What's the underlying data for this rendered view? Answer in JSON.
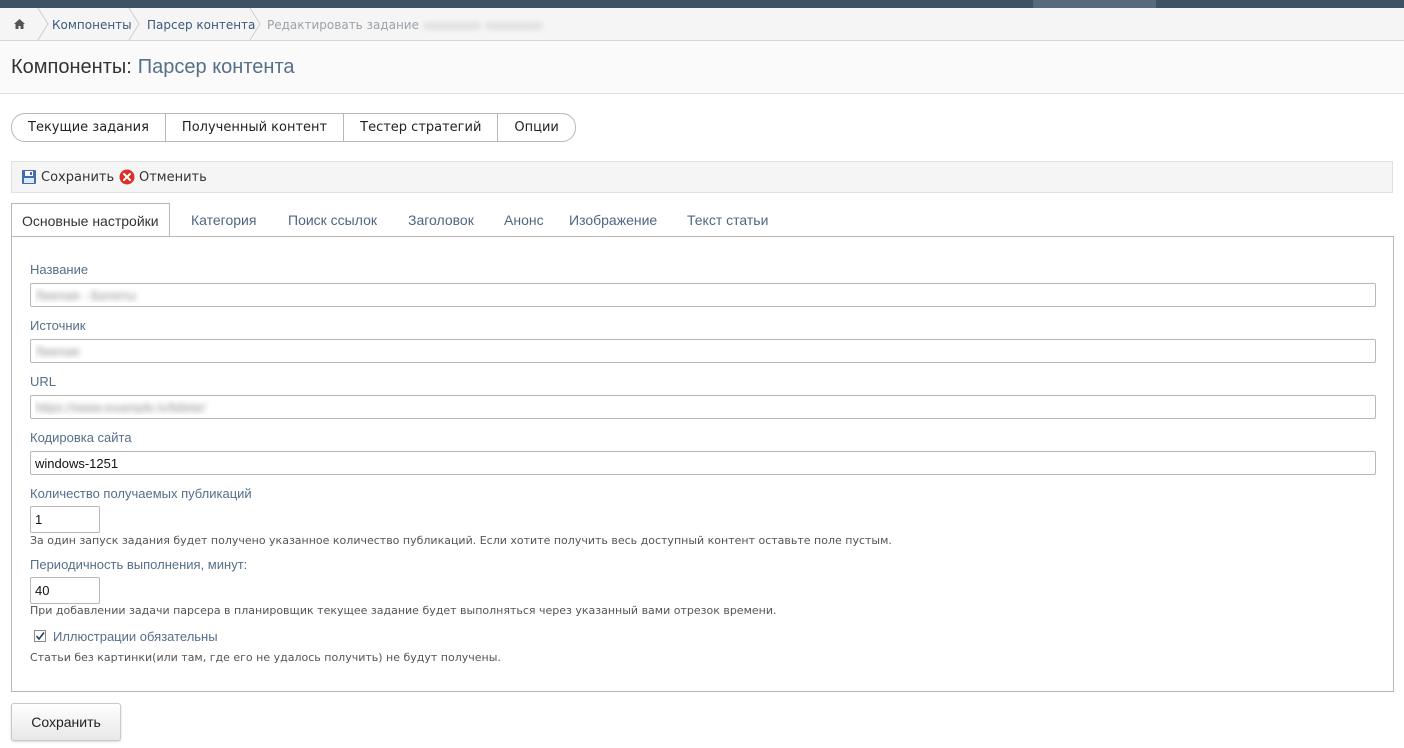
{
  "breadcrumb": {
    "items": [
      "Компоненты",
      "Парсер контента"
    ],
    "current": "Редактировать задание"
  },
  "header": {
    "title": "Компоненты:",
    "subtitle": "Парсер контента"
  },
  "nav": {
    "pills": [
      "Текущие задания",
      "Полученный контент",
      "Тестер стратегий",
      "Опции"
    ]
  },
  "toolbar": {
    "save_label": "Сохранить",
    "cancel_label": "Отменить"
  },
  "tabs": [
    "Основные настройки",
    "Категория",
    "Поиск ссылок",
    "Заголовок",
    "Анонс",
    "Изображение",
    "Текст статьи"
  ],
  "form": {
    "name_label": "Название",
    "source_label": "Источник",
    "url_label": "URL",
    "encoding_label": "Кодировка сайта",
    "encoding_value": "windows-1251",
    "count_label": "Количество получаемых публикаций",
    "count_value": "1",
    "count_hint": "За один запуск задания будет получено указанное количество публикаций. Если хотите получить весь доступный контент оставьте поле пустым.",
    "period_label": "Периодичность выполнения, минут:",
    "period_value": "40",
    "period_hint": "При добавлении задачи парсера в планировщик текущее задание будет выполняться через указанный вами отрезок времени.",
    "illustrations_label": "Иллюстрации обязательны",
    "illustrations_checked": true,
    "illustrations_hint": "Статьи без картинки(или там, где его не удалось получить) не будут получены."
  },
  "footer": {
    "save_label": "Сохранить"
  },
  "colors": {
    "accent": "#566f89",
    "topbar": "#3e5266"
  },
  "icons": {
    "home": "home-icon",
    "save": "floppy-disk-icon",
    "cancel": "cancel-icon",
    "check": "check-icon"
  }
}
